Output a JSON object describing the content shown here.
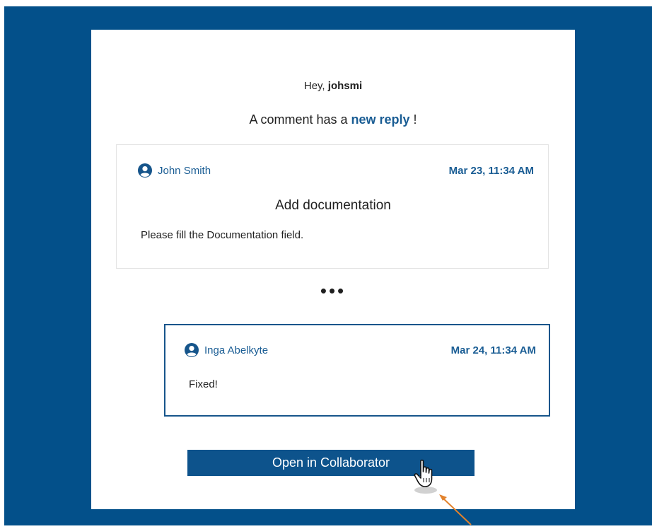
{
  "email": {
    "greeting_prefix": "Hey, ",
    "username": "johsmi",
    "headline_prefix": "A comment has a ",
    "headline_link": "new reply",
    "headline_suffix": " !"
  },
  "comment": {
    "author": "John Smith",
    "date": "Mar 23, 11:34 AM",
    "title": "Add documentation",
    "body": "Please fill the Documentation field."
  },
  "ellipsis": "•••",
  "reply": {
    "author": "Inga Abelkyte",
    "date": "Mar 24, 11:34 AM",
    "body": "Fixed!"
  },
  "button": {
    "label": "Open in Collaborator"
  },
  "colors": {
    "background": "#03508a",
    "accent": "#1a5d94",
    "button": "#0d538c",
    "annotation_arrow": "#e2822c"
  },
  "icons": {
    "author_icon": "user-circle-icon",
    "cursor": "hand-pointer-icon",
    "annotation": "arrow-icon"
  }
}
